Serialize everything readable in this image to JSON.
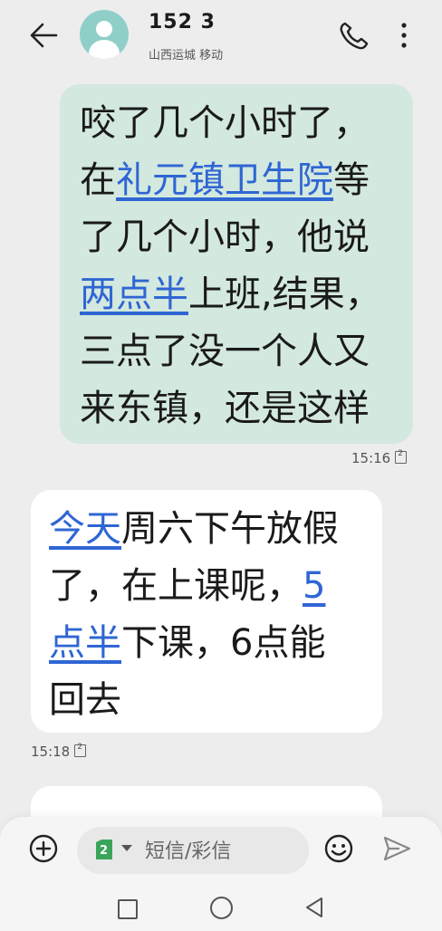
{
  "header": {
    "contact_number": "152 3",
    "contact_location": "山西运城 移动"
  },
  "messages": [
    {
      "direction": "outgoing",
      "lines": [
        [
          {
            "text": "咬了几个小时了，",
            "link": false
          }
        ],
        [
          {
            "text": "在",
            "link": false
          },
          {
            "text": "礼元镇卫生院",
            "link": true
          },
          {
            "text": "等",
            "link": false
          }
        ],
        [
          {
            "text": "了几个小时，他说",
            "link": false
          }
        ],
        [
          {
            "text": "两点半",
            "link": true
          },
          {
            "text": "上班,结果，",
            "link": false
          }
        ],
        [
          {
            "text": "三点了没一个人又",
            "link": false
          }
        ],
        [
          {
            "text": "来东镇，还是这样",
            "link": false
          }
        ]
      ],
      "time": "15:16"
    },
    {
      "direction": "incoming",
      "lines": [
        [
          {
            "text": "今天",
            "link": true
          },
          {
            "text": "周六下午放假",
            "link": false
          }
        ],
        [
          {
            "text": "了，在上课呢，",
            "link": false
          },
          {
            "text": "5",
            "link": true
          }
        ],
        [
          {
            "text": "点半",
            "link": true
          },
          {
            "text": "下课，6点能",
            "link": false
          }
        ],
        [
          {
            "text": "回去",
            "link": false
          }
        ]
      ],
      "time": "15:18"
    }
  ],
  "composer": {
    "sim_label": "2",
    "placeholder": "短信/彩信"
  },
  "icons": {
    "back": "arrow-left-icon",
    "call": "phone-icon",
    "more": "more-vertical-icon",
    "add": "plus-circle-icon",
    "emoji": "emoji-icon",
    "send": "send-icon",
    "sim": "sim-card-icon"
  },
  "colors": {
    "background": "#ededed",
    "outgoing_bubble": "#d3e8de",
    "incoming_bubble": "#ffffff",
    "link": "#2f66d4",
    "avatar": "#8fcfc7",
    "sim_green": "#3aa55a"
  }
}
